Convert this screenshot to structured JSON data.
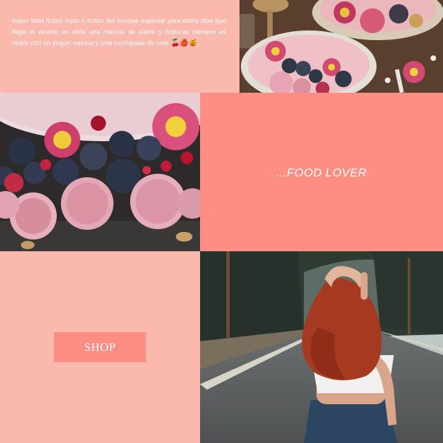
{
  "caption": {
    "text": "duper food frutos rojos o frutos del bosque especial para estoy dias que llega el verano en chile una mezcla de sabor y texturas siempre es mejor con un yogurt natural y una cucharada de miel",
    "emojis": "🍒🍎🍯"
  },
  "banner": {
    "label": "...FOOD LOVER"
  },
  "shop": {
    "label": "SHOP"
  },
  "colors": {
    "pink_background": "#fbb9ad",
    "coral_accent": "#fe8d83",
    "text_white": "#ffffff"
  }
}
